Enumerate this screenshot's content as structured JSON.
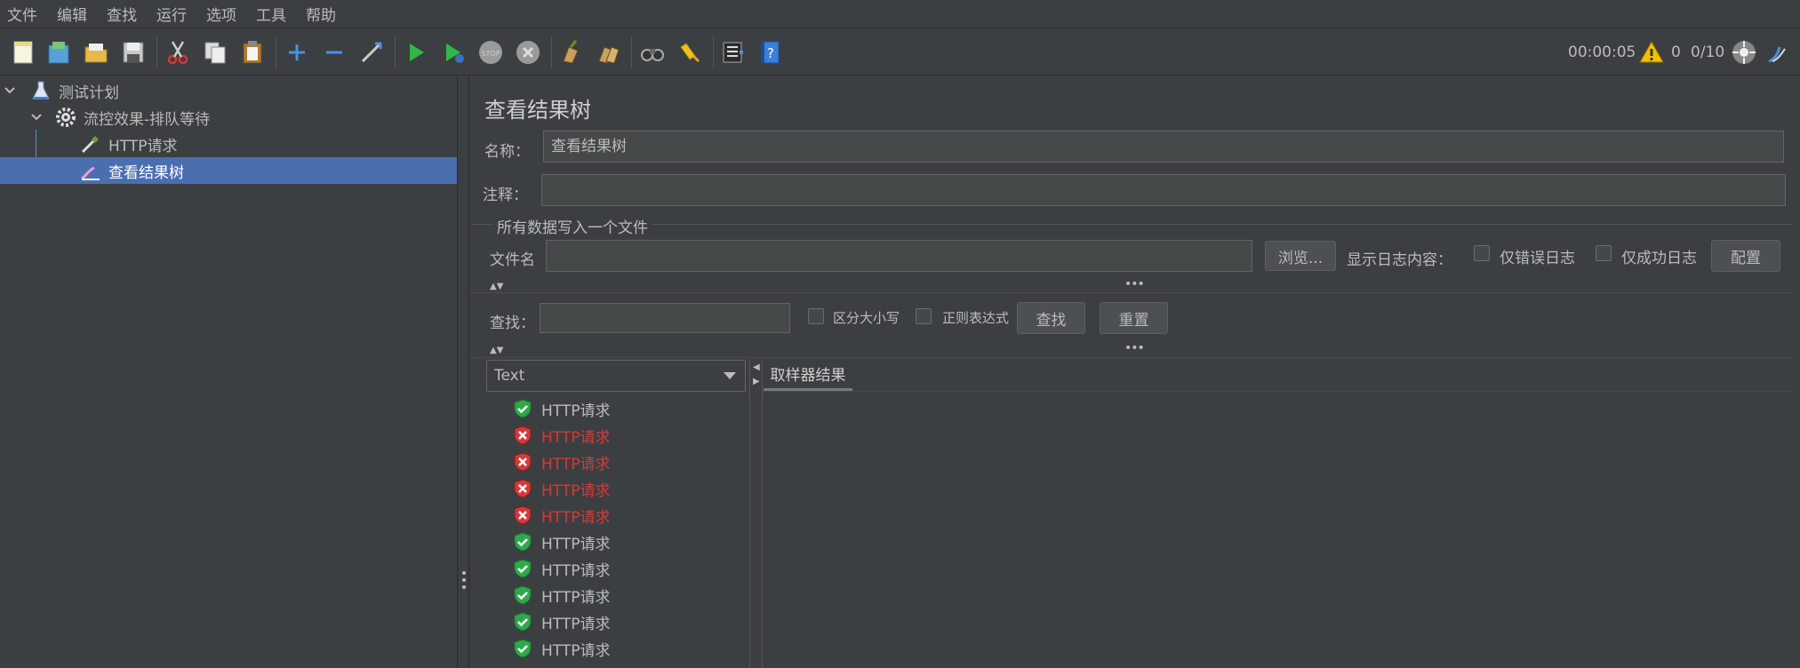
{
  "menu": [
    "文件",
    "编辑",
    "查找",
    "运行",
    "选项",
    "工具",
    "帮助"
  ],
  "toolbar": {
    "icons": [
      "new-icon",
      "templates-icon",
      "open-icon",
      "save-icon",
      "cut-icon",
      "copy-icon",
      "paste-icon",
      "expand-icon",
      "collapse-icon",
      "toggle-icon",
      "start-icon",
      "start-no-pause-icon",
      "stop-icon",
      "shutdown-icon",
      "clear-icon",
      "clear-all-icon",
      "search-icon",
      "reset-search-icon",
      "function-helper-icon",
      "help-icon"
    ],
    "timer": "00:00:05",
    "warnings": "0",
    "threads": "0/10"
  },
  "tree": {
    "items": [
      {
        "label": "测试计划",
        "icon": "flask-icon"
      },
      {
        "label": "流控效果-排队等待",
        "icon": "gear-icon"
      },
      {
        "label": "HTTP请求",
        "icon": "pipette-icon"
      },
      {
        "label": "查看结果树",
        "icon": "chart-icon"
      }
    ]
  },
  "panel": {
    "title": "查看结果树",
    "name_label": "名称：",
    "name_value": "查看结果树",
    "comment_label": "注释：",
    "comment_value": "",
    "file_group": "所有数据写入一个文件",
    "filename_label": "文件名",
    "filename_value": "",
    "browse": "浏览...",
    "log_label": "显示日志内容：",
    "errors_only": "仅错误日志",
    "success_only": "仅成功日志",
    "configure": "配置",
    "search_label": "查找：",
    "search_value": "",
    "case_sensitive": "区分大小写",
    "regex": "正则表达式",
    "find": "查找",
    "reset": "重置",
    "renderer": "Text",
    "tab_sampler": "取样器结果"
  },
  "results": [
    {
      "label": "HTTP请求",
      "status": "ok"
    },
    {
      "label": "HTTP请求",
      "status": "fail"
    },
    {
      "label": "HTTP请求",
      "status": "fail"
    },
    {
      "label": "HTTP请求",
      "status": "fail"
    },
    {
      "label": "HTTP请求",
      "status": "fail"
    },
    {
      "label": "HTTP请求",
      "status": "ok"
    },
    {
      "label": "HTTP请求",
      "status": "ok"
    },
    {
      "label": "HTTP请求",
      "status": "ok"
    },
    {
      "label": "HTTP请求",
      "status": "ok"
    },
    {
      "label": "HTTP请求",
      "status": "ok"
    }
  ],
  "colors": {
    "accent": "#4b6eaf",
    "ok": "#2ea84a",
    "fail": "#d33a3a"
  }
}
